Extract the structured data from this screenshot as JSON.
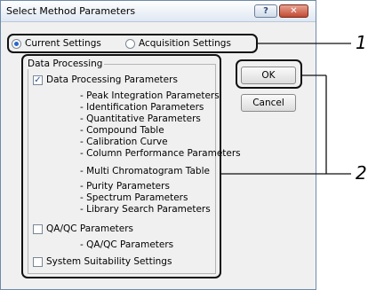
{
  "window": {
    "title": "Select Method Parameters",
    "help_label": "?",
    "close_label": "✕"
  },
  "settings_radio": {
    "options": [
      {
        "label": "Current Settings",
        "selected": true
      },
      {
        "label": "Acquisition Settings",
        "selected": false
      }
    ]
  },
  "data_processing": {
    "group_label": "Data Processing",
    "main_checkbox": {
      "label": "Data Processing Parameters",
      "checked": true
    },
    "items": [
      "- Peak Integration Parameters",
      "- Identification Parameters",
      "- Quantitative Parameters",
      "- Compound Table",
      "- Calibration Curve",
      "- Column Performance Parameters",
      "- Multi Chromatogram Table",
      "- Purity Parameters",
      "- Spectrum Parameters",
      "- Library Search Parameters"
    ],
    "qaqc_checkbox": {
      "label": "QA/QC Parameters",
      "checked": false
    },
    "qaqc_item": "- QA/QC Parameters",
    "suitability_checkbox": {
      "label": "System Suitability Settings",
      "checked": false
    }
  },
  "buttons": {
    "ok_label": "OK",
    "cancel_label": "Cancel"
  },
  "callouts": {
    "one": "1",
    "two": "2"
  }
}
